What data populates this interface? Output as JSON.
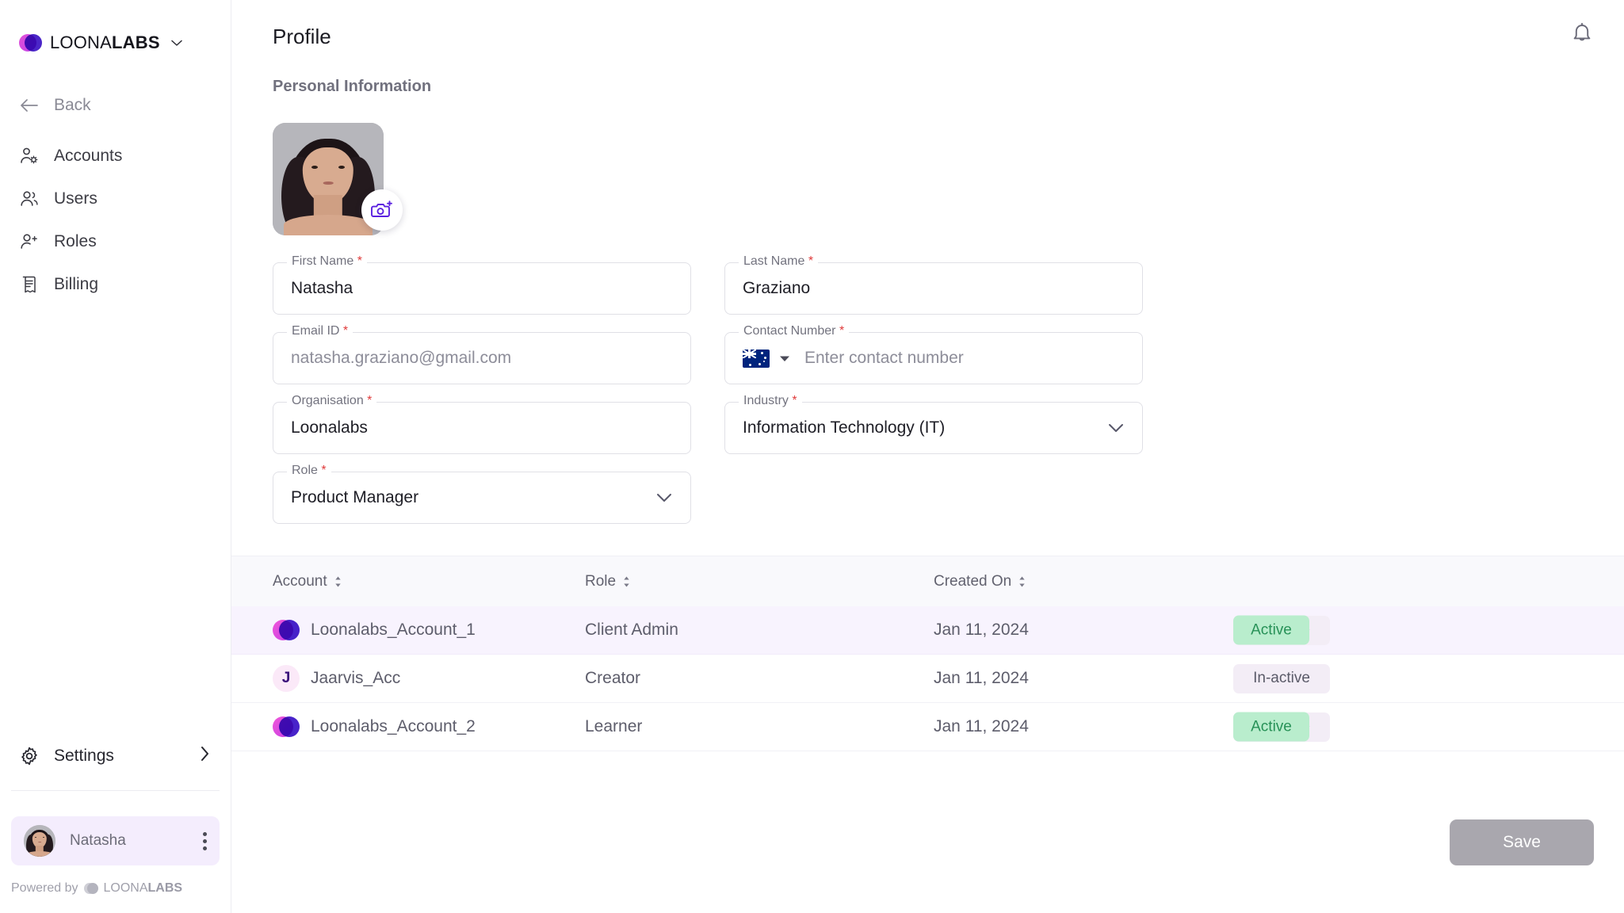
{
  "sidebar": {
    "brand": {
      "name_light": "LOONA",
      "name_bold": "LABS",
      "caret": "chevron-down"
    },
    "back_label": "Back",
    "items": [
      {
        "label": "Accounts",
        "icon": "account-settings-icon"
      },
      {
        "label": "Users",
        "icon": "users-icon"
      },
      {
        "label": "Roles",
        "icon": "user-add-icon"
      },
      {
        "label": "Billing",
        "icon": "receipt-icon"
      }
    ],
    "settings_label": "Settings",
    "user": {
      "name": "Natasha"
    },
    "powered_prefix": "Powered by",
    "powered_brand_light": "LOONA",
    "powered_brand_bold": "LABS"
  },
  "header": {
    "title": "Profile",
    "bell_icon": "notification-bell-icon"
  },
  "personal": {
    "section_label": "Personal Information",
    "avatar_alt": "Natasha Graziano profile photo",
    "camera_badge_icon": "camera-add-icon"
  },
  "form": {
    "first_name": {
      "label": "First Name",
      "required": "*",
      "value": "Natasha"
    },
    "last_name": {
      "label": "Last Name",
      "required": "*",
      "value": "Graziano"
    },
    "email": {
      "label": "Email ID",
      "required": "*",
      "value": "natasha.graziano@gmail.com"
    },
    "contact": {
      "label": "Contact Number",
      "required": "*",
      "placeholder": "Enter contact number",
      "value": "",
      "flag": "australia-flag"
    },
    "organisation": {
      "label": "Organisation",
      "required": "*",
      "value": "Loonalabs"
    },
    "industry": {
      "label": "Industry",
      "required": "*",
      "value": "Information Technology (IT)"
    },
    "role": {
      "label": "Role",
      "required": "*",
      "value": "Product Manager"
    }
  },
  "table": {
    "columns": [
      {
        "key": "account",
        "label": "Account",
        "sortable": true
      },
      {
        "key": "role",
        "label": "Role",
        "sortable": true
      },
      {
        "key": "created_on",
        "label": "Created On",
        "sortable": true
      },
      {
        "key": "status",
        "label": "",
        "sortable": false
      }
    ],
    "rows": [
      {
        "account": "Loonalabs_Account_1",
        "avatar_type": "logo",
        "avatar_letter": "",
        "role": "Client Admin",
        "created_on": "Jan 11, 2024",
        "status_base": "In-active",
        "status_overlay": "Active",
        "selected": true
      },
      {
        "account": "Jaarvis_Acc",
        "avatar_type": "letter",
        "avatar_letter": "J",
        "role": "Creator",
        "created_on": "Jan 11, 2024",
        "status_base": "In-active",
        "status_overlay": "",
        "selected": false
      },
      {
        "account": "Loonalabs_Account_2",
        "avatar_type": "logo",
        "avatar_letter": "",
        "role": "Learner",
        "created_on": "Jan 11, 2024",
        "status_base": "In-active",
        "status_overlay": "Active",
        "selected": false
      }
    ]
  },
  "footer": {
    "save_label": "Save"
  },
  "colors": {
    "brand_purple": "#3b13c4",
    "brand_magenta": "#d94ee0",
    "accent_violet": "#5b21e0",
    "row_selected": "#f8f3fe",
    "status_active_bg": "#b9edcd",
    "status_active_text": "#279157",
    "status_inactive_bg": "#f3edf6",
    "status_inactive_text": "#5a5a68",
    "save_disabled_bg": "#a9a7ae",
    "required_red": "#e03b3b"
  }
}
